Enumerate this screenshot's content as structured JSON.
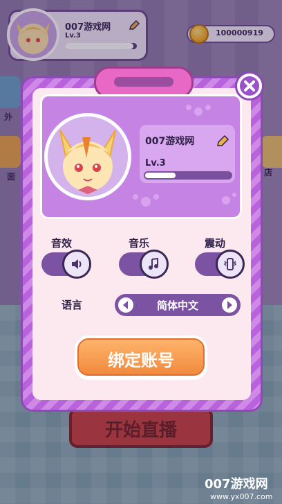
{
  "hud": {
    "player_name": "007游戏网",
    "level": "Lv.3",
    "exp_progress": 0.95,
    "coins": "100000919"
  },
  "side_buttons": {
    "left_1_label": "外",
    "left_2_label": "面",
    "right_label": "店"
  },
  "start_button_label": "开始直播",
  "profile": {
    "name": "007游戏网",
    "level": "Lv.3",
    "exp_progress": 0.34
  },
  "settings": {
    "sound_label": "音效",
    "music_label": "音乐",
    "vibration_label": "震动",
    "sound_on": true,
    "music_on": true,
    "vibration_on": true,
    "language_label": "语言",
    "language_value": "简体中文"
  },
  "bind_account_label": "绑定账号",
  "watermark": {
    "title": "007游戏网",
    "url": "www.yx007.com"
  },
  "colors": {
    "modal_purple": "#b863db",
    "accent_orange": "#f08a3e",
    "handle_pink": "#e868c6",
    "toggle_track": "#7c52a3"
  },
  "icons": {
    "close": "close-icon",
    "edit": "pencil-icon",
    "sound": "speaker-icon",
    "music": "music-note-icon",
    "vibration": "vibrate-icon",
    "coin": "coin-icon"
  }
}
